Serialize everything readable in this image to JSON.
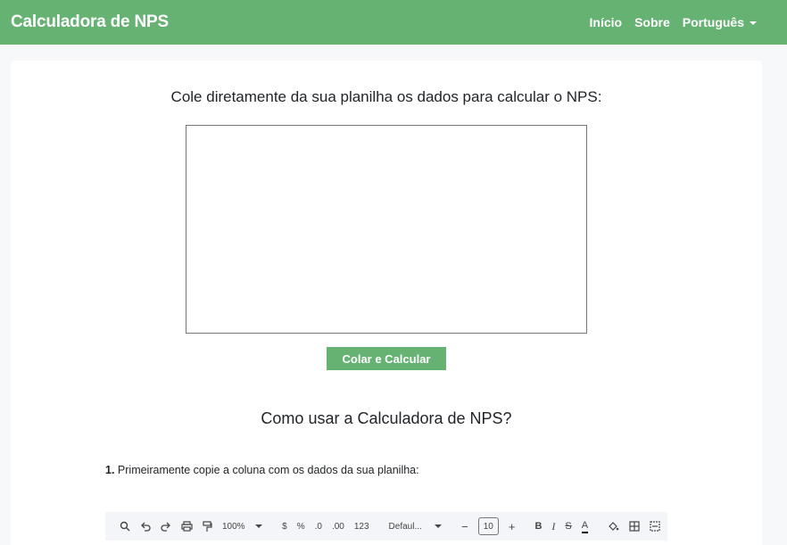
{
  "navbar": {
    "brand": "Calculadora de NPS",
    "links": {
      "home": "Início",
      "about": "Sobre",
      "language": "Português"
    },
    "color": "#66b273"
  },
  "main": {
    "intro": "Cole diretamente da sua planilha os dados para calcular o NPS:",
    "textarea_value": "",
    "calculate_button": "Colar e Calcular",
    "how_title": "Como usar a Calculadora de NPS?",
    "step1_number": "1.",
    "step1_text": " Primeiramente copie a coluna com os dados da sua planilha:"
  },
  "spreadsheet_toolbar": {
    "zoom": "100%",
    "currency": "$",
    "percent": "%",
    "decrease_decimal": ".0",
    "increase_decimal": ".00",
    "number_format": "123",
    "font": "Defaul...",
    "minus": "−",
    "font_size": "10",
    "plus": "+",
    "bold": "B",
    "italic": "I",
    "strikethrough": "S",
    "text_color": "A",
    "icons": [
      "search-icon",
      "undo-icon",
      "redo-icon",
      "print-icon",
      "paint-format-icon",
      "fill-color-icon",
      "borders-icon",
      "merge-cells-icon"
    ]
  }
}
